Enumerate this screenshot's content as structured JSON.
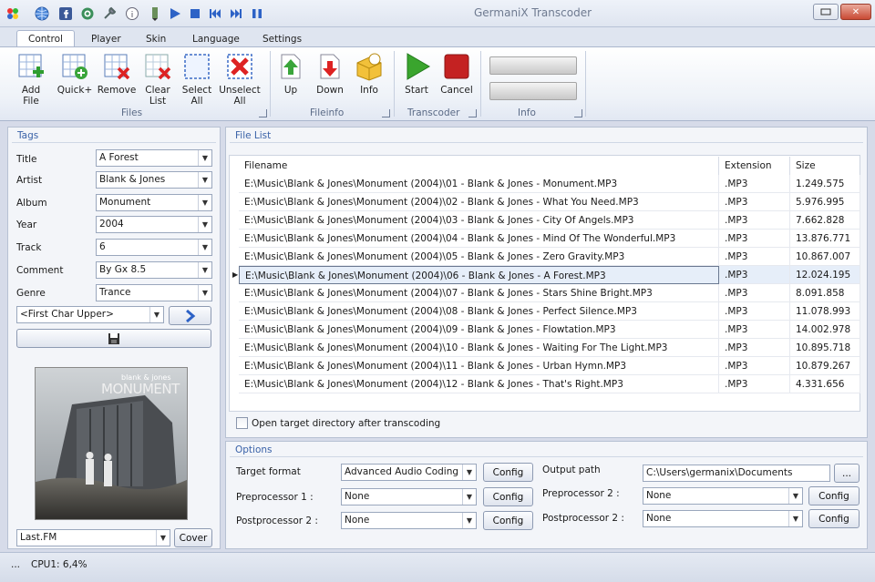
{
  "window": {
    "title": "GermaniX Transcoder"
  },
  "tabs": [
    {
      "label": "Control"
    },
    {
      "label": "Player"
    },
    {
      "label": "Skin"
    },
    {
      "label": "Language"
    },
    {
      "label": "Settings"
    }
  ],
  "ribbon": {
    "buttons": {
      "add_file": "Add File",
      "quick_plus": "Quick+",
      "remove": "Remove",
      "clear_list_1": "Clear",
      "clear_list_2": "List",
      "select_all_1": "Select",
      "select_all_2": "All",
      "unselect_all_1": "Unselect",
      "unselect_all_2": "All",
      "up": "Up",
      "down": "Down",
      "info": "Info",
      "start": "Start",
      "cancel": "Cancel"
    },
    "groups": {
      "files": "Files",
      "fileinfo": "Fileinfo",
      "transcoder": "Transcoder",
      "info": "Info"
    }
  },
  "tags": {
    "panel_title": "Tags",
    "title_label": "Title",
    "title_value": "A Forest",
    "artist_label": "Artist",
    "artist_value": "Blank & Jones",
    "album_label": "Album",
    "album_value": "Monument",
    "year_label": "Year",
    "year_value": "2004",
    "track_label": "Track",
    "track_value": "6",
    "comment_label": "Comment",
    "comment_value": "By Gx 8.5",
    "genre_label": "Genre",
    "genre_value": "Trance",
    "case_value": "<First Char Upper>",
    "cover_source": "Last.FM",
    "cover_button": "Cover",
    "album_art_text_1": "blank & jones",
    "album_art_text_2": "MONUMENT"
  },
  "file_list": {
    "panel_title": "File List",
    "columns": {
      "filename": "Filename",
      "extension": "Extension",
      "size": "Size"
    },
    "rows": [
      {
        "file": "E:\\Music\\Blank & Jones\\Monument (2004)\\01 - Blank & Jones - Monument.MP3",
        "ext": ".MP3",
        "size": "1.249.575"
      },
      {
        "file": "E:\\Music\\Blank & Jones\\Monument (2004)\\02 - Blank & Jones - What You Need.MP3",
        "ext": ".MP3",
        "size": "5.976.995"
      },
      {
        "file": "E:\\Music\\Blank & Jones\\Monument (2004)\\03 - Blank & Jones - City Of Angels.MP3",
        "ext": ".MP3",
        "size": "7.662.828"
      },
      {
        "file": "E:\\Music\\Blank & Jones\\Monument (2004)\\04 - Blank & Jones - Mind Of The Wonderful.MP3",
        "ext": ".MP3",
        "size": "13.876.771"
      },
      {
        "file": "E:\\Music\\Blank & Jones\\Monument (2004)\\05 - Blank & Jones - Zero Gravity.MP3",
        "ext": ".MP3",
        "size": "10.867.007"
      },
      {
        "file": "E:\\Music\\Blank & Jones\\Monument (2004)\\06 - Blank & Jones - A Forest.MP3",
        "ext": ".MP3",
        "size": "12.024.195"
      },
      {
        "file": "E:\\Music\\Blank & Jones\\Monument (2004)\\07 - Blank & Jones - Stars Shine Bright.MP3",
        "ext": ".MP3",
        "size": "8.091.858"
      },
      {
        "file": "E:\\Music\\Blank & Jones\\Monument (2004)\\08 - Blank & Jones - Perfect Silence.MP3",
        "ext": ".MP3",
        "size": "11.078.993"
      },
      {
        "file": "E:\\Music\\Blank & Jones\\Monument (2004)\\09 - Blank & Jones - Flowtation.MP3",
        "ext": ".MP3",
        "size": "14.002.978"
      },
      {
        "file": "E:\\Music\\Blank & Jones\\Monument (2004)\\10 - Blank & Jones - Waiting For The Light.MP3",
        "ext": ".MP3",
        "size": "10.895.718"
      },
      {
        "file": "E:\\Music\\Blank & Jones\\Monument (2004)\\11 - Blank & Jones - Urban Hymn.MP3",
        "ext": ".MP3",
        "size": "10.879.267"
      },
      {
        "file": "E:\\Music\\Blank & Jones\\Monument (2004)\\12 - Blank & Jones - That's Right.MP3",
        "ext": ".MP3",
        "size": "4.331.656"
      }
    ],
    "open_target_label": "Open target directory after transcoding"
  },
  "options": {
    "panel_title": "Options",
    "target_format_label": "Target format",
    "target_format_value": "Advanced Audio Coding (A",
    "pre1_label": "Preprocessor 1 :",
    "pre1_value": "None",
    "post2_left_label": "Postprocessor 2 :",
    "post2_left_value": "None",
    "output_path_label": "Output path",
    "output_path_value": "C:\\Users\\germanix\\Documents",
    "browse_label": "...",
    "pre2_label": "Preprocessor 2 :",
    "pre2_value": "None",
    "post2_right_label": "Postprocessor 2 :",
    "post2_right_value": "None",
    "config_label": "Config"
  },
  "status": {
    "ellipsis": "...",
    "cpu": "CPU1: 6,4%"
  },
  "colors": {
    "accent": "#3a62a8",
    "selected_row": "#e6eef9",
    "start_green": "#3aa52e",
    "cancel_red": "#c42222"
  }
}
